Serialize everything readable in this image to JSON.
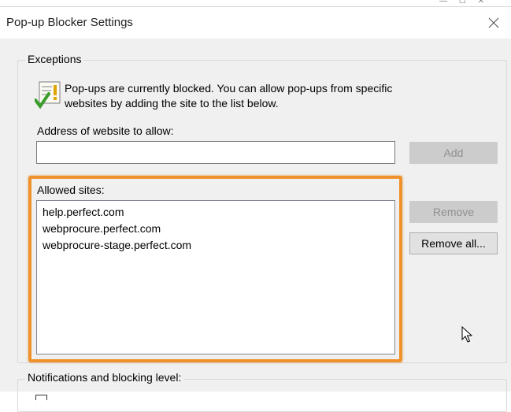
{
  "window": {
    "title": "Pop-up Blocker Settings"
  },
  "exceptions": {
    "group_label": "Exceptions",
    "info_line1": "Pop-ups are currently blocked.  You can allow pop-ups from specific",
    "info_line2": "websites by adding the site to the list below.",
    "address_label": "Address of website to allow:",
    "address_value": "",
    "add_button": "Add",
    "allowed_sites_label": "Allowed sites:",
    "allowed_sites": [
      "help.perfect.com",
      "webprocure.perfect.com",
      "webprocure-stage.perfect.com"
    ],
    "remove_button": "Remove",
    "remove_all_button": "Remove all..."
  },
  "notifications": {
    "group_label": "Notifications and blocking level:"
  },
  "colors": {
    "highlight": "#f0922b",
    "dialog_background": "#f0f0f0",
    "disabled_button": "#cccccc"
  },
  "icons": [
    "info-shield-checkmark-icon",
    "close-icon",
    "mouse-pointer-icon"
  ]
}
